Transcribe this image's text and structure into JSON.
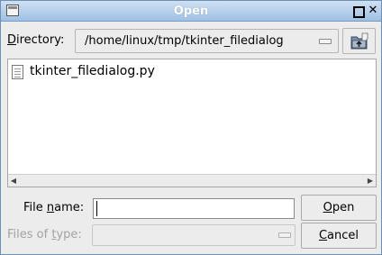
{
  "window": {
    "title": "Open"
  },
  "directory": {
    "label_prefix": "",
    "label_accel": "D",
    "label_rest": "irectory:",
    "value": "/home/linux/tmp/tkinter_filedialog"
  },
  "files": [
    {
      "name": "tkinter_filedialog.py"
    }
  ],
  "filename": {
    "label_prefix": "File ",
    "label_accel": "n",
    "label_rest": "ame:",
    "value": ""
  },
  "filetype": {
    "label_prefix": "Files of ",
    "label_accel": "t",
    "label_rest": "ype:",
    "value": ""
  },
  "buttons": {
    "open_accel": "O",
    "open_rest": "pen",
    "cancel_accel": "C",
    "cancel_rest": "ancel"
  },
  "icons": {
    "window": "window-menu-icon",
    "maximize": "maximize-icon",
    "close": "close-icon",
    "up": "folder-up-icon",
    "file": "file-icon"
  }
}
